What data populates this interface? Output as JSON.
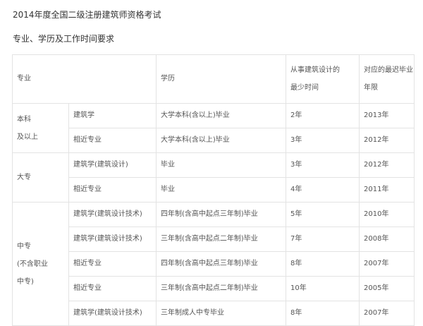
{
  "document": {
    "title": "2014年度全国二级注册建筑师资格考试",
    "subtitle": "专业、学历及工作时间要求"
  },
  "table": {
    "headers": {
      "major": "专业",
      "education": "学历",
      "min_years": "从事建筑设计的\n最少时间",
      "graduation_year": "对应的最迟毕业\n年限"
    },
    "groups": {
      "bachelor": "本科\n及以上",
      "college": "大专",
      "technical": "中专\n(不含职业\n中专)"
    },
    "rows": [
      {
        "major": "建筑学",
        "education": "大学本科(含以上)毕业",
        "years": "2年",
        "year_limit": "2013年"
      },
      {
        "major": "相近专业",
        "education": "大学本科(含以上)毕业",
        "years": "3年",
        "year_limit": "2012年"
      },
      {
        "major": "建筑学(建筑设计)",
        "education": "毕业",
        "years": "3年",
        "year_limit": "2012年"
      },
      {
        "major": "相近专业",
        "education": "毕业",
        "years": "4年",
        "year_limit": "2011年"
      },
      {
        "major": "建筑学(建筑设计技术)",
        "education": "四年制(含高中起点三年制)毕业",
        "years": "5年",
        "year_limit": "2010年"
      },
      {
        "major": "建筑学(建筑设计技术)",
        "education": "三年制(含高中起点二年制)毕业",
        "years": "7年",
        "year_limit": "2008年"
      },
      {
        "major": "相近专业",
        "education": "四年制(含高中起点三年制)毕业",
        "years": "8年",
        "year_limit": "2007年"
      },
      {
        "major": "相近专业",
        "education": "三年制(含高中起点二年制)毕业",
        "years": "10年",
        "year_limit": "2005年"
      },
      {
        "major": "建筑学(建筑设计技术)",
        "education": "三年制成人中专毕业",
        "years": "8年",
        "year_limit": "2007年"
      }
    ]
  }
}
